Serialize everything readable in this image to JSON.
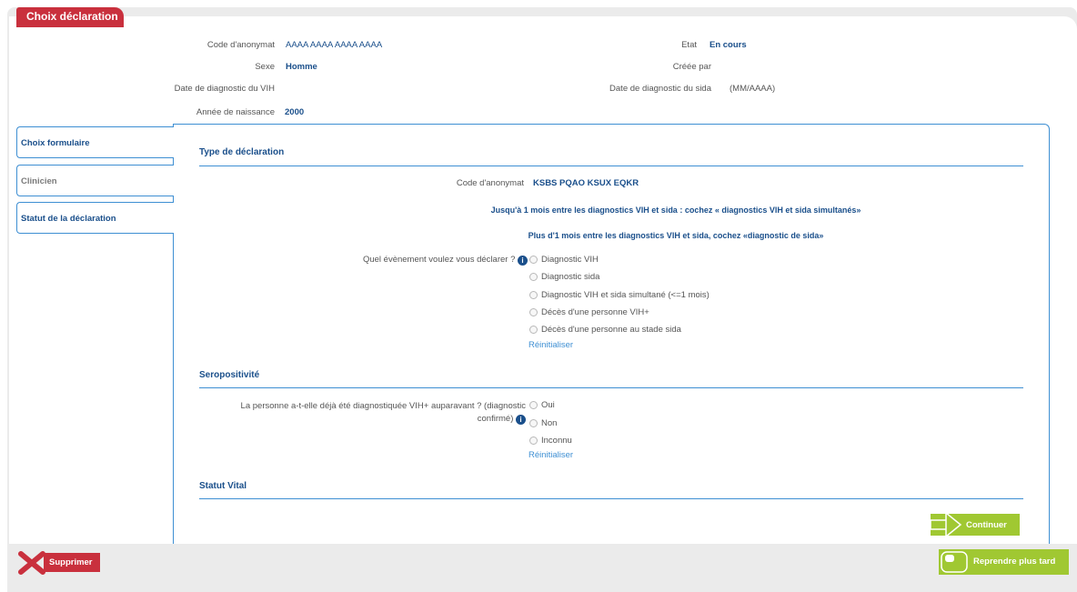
{
  "page": {
    "title": "Choix déclaration"
  },
  "header": {
    "code_label": "Code d'anonymat",
    "code_value": "AAAA AAAA AAAA AAAA",
    "etat_label": "Etat",
    "etat_value": "En cours",
    "sexe_label": "Sexe",
    "sexe_value": "Homme",
    "creee_label": "Créée par",
    "vih_label": "Date de diagnostic du VIH",
    "sida_label": "Date de diagnostic du sida",
    "sida_value": "(MM/AAAA)",
    "annee_label": "Année de naissance",
    "annee_value": "2000"
  },
  "tabs": [
    {
      "label": "Choix formulaire"
    },
    {
      "label": "Clinicien"
    },
    {
      "label": "Statut de la déclaration"
    }
  ],
  "type_section": {
    "title": "Type de déclaration",
    "code_label": "Code d'anonymat",
    "code_value": "KSBS PQAO KSUX EQKR",
    "info1": "Jusqu'à 1 mois entre les diagnostics VIH et sida : cochez « diagnostics VIH et sida simultanés»",
    "info2": "Plus d'1 mois entre les diagnostics VIH et sida, cochez «diagnostic de sida»",
    "question": "Quel évènement voulez vous déclarer ?",
    "options": [
      "Diagnostic VIH",
      "Diagnostic sida",
      "Diagnostic VIH et sida simultané (<=1 mois)",
      "Décès d'une personne VIH+",
      "Décès d'une personne au stade sida"
    ],
    "reset": "Réinitialiser"
  },
  "sero_section": {
    "title": "Seropositivité",
    "question_line1": "La personne a-t-elle déjà été diagnostiquée VIH+ auparavant ? (diagnostic",
    "question_line2": "confirmé)",
    "options": [
      "Oui",
      "Non",
      "Inconnu"
    ],
    "reset": "Réinitialiser"
  },
  "vital_section": {
    "title": "Statut Vital"
  },
  "info_glyph": "i",
  "buttons": {
    "continue": "Continuer",
    "delete": "Supprimer",
    "later": "Reprendre plus tard"
  },
  "colors": {
    "brand_red": "#c9303d",
    "brand_blue": "#1a4f8b",
    "accent_blue": "#3e8fd3",
    "green": "#a0c832"
  }
}
